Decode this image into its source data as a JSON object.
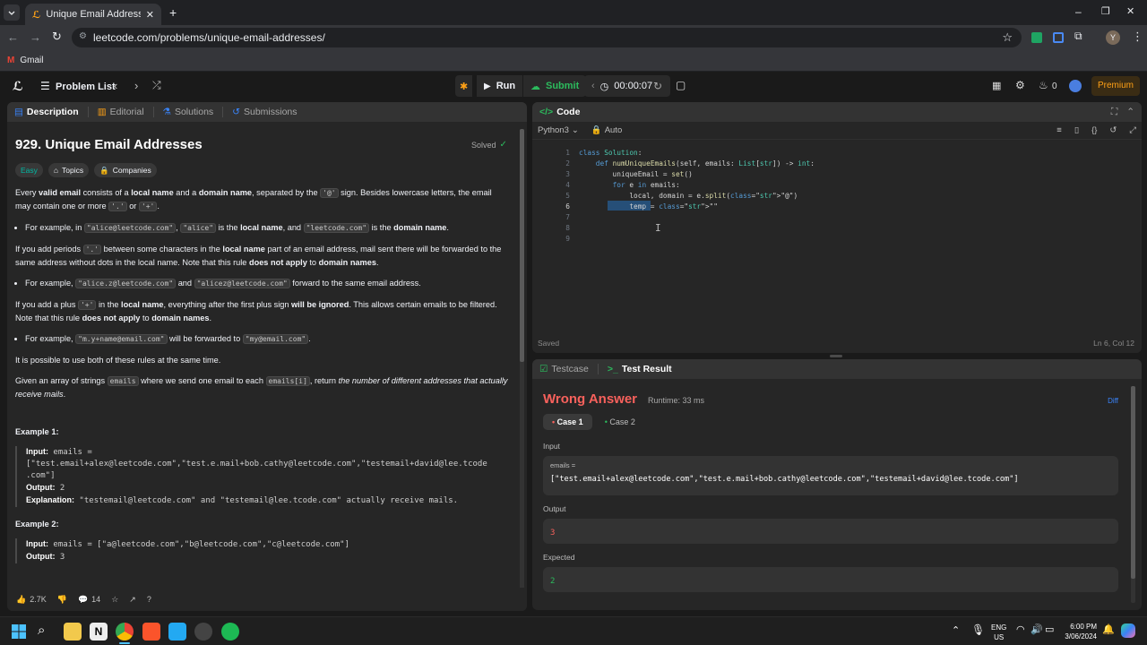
{
  "browser": {
    "tab_title": "Unique Email Addresses - LeetCode",
    "url": "leetcode.com/problems/unique-email-addresses/",
    "bookmark": "Gmail",
    "profile_initial": "Y"
  },
  "nav": {
    "problem_list": "Problem List",
    "run": "Run",
    "submit": "Submit",
    "timer": "00:00:07",
    "fire_count": "0",
    "premium": "Premium"
  },
  "desc": {
    "tabs": [
      "Description",
      "Editorial",
      "Solutions",
      "Submissions"
    ],
    "title": "929. Unique Email Addresses",
    "solved": "Solved",
    "tags": [
      "Easy",
      "Topics",
      "Companies"
    ],
    "likes": "2.7K",
    "comments": "14"
  },
  "code": {
    "tab": "Code",
    "language": "Python3",
    "mode": "Auto",
    "lines": [
      "class Solution:",
      "    def numUniqueEmails(self, emails: List[str]) -> int:",
      "        uniqueEmail = set()",
      "        for e in emails:",
      "            local, domain = e.split(\"@\")",
      "            temp = \"\"",
      "",
      "",
      ""
    ],
    "status": "Saved",
    "cursor": "Ln 6, Col 12"
  },
  "test": {
    "tabs": [
      "Testcase",
      "Test Result"
    ],
    "verdict": "Wrong Answer",
    "runtime": "Runtime: 33 ms",
    "diff": "Diff",
    "cases": [
      "Case 1",
      "Case 2"
    ],
    "input_label": "Input",
    "var_name": "emails =",
    "input_value": "[\"test.email+alex@leetcode.com\",\"test.e.mail+bob.cathy@leetcode.com\",\"testemail+david@lee.tcode.com\"]",
    "output_label": "Output",
    "output_value": "3",
    "expected_label": "Expected",
    "expected_value": "2"
  },
  "taskbar": {
    "lang_top": "ENG",
    "lang_bottom": "US",
    "time": "6:00 PM",
    "date": "3/06/2024"
  },
  "colors": {
    "accent": "#ffa116",
    "wrong": "#f8615c",
    "ok": "#2cbb5d"
  }
}
